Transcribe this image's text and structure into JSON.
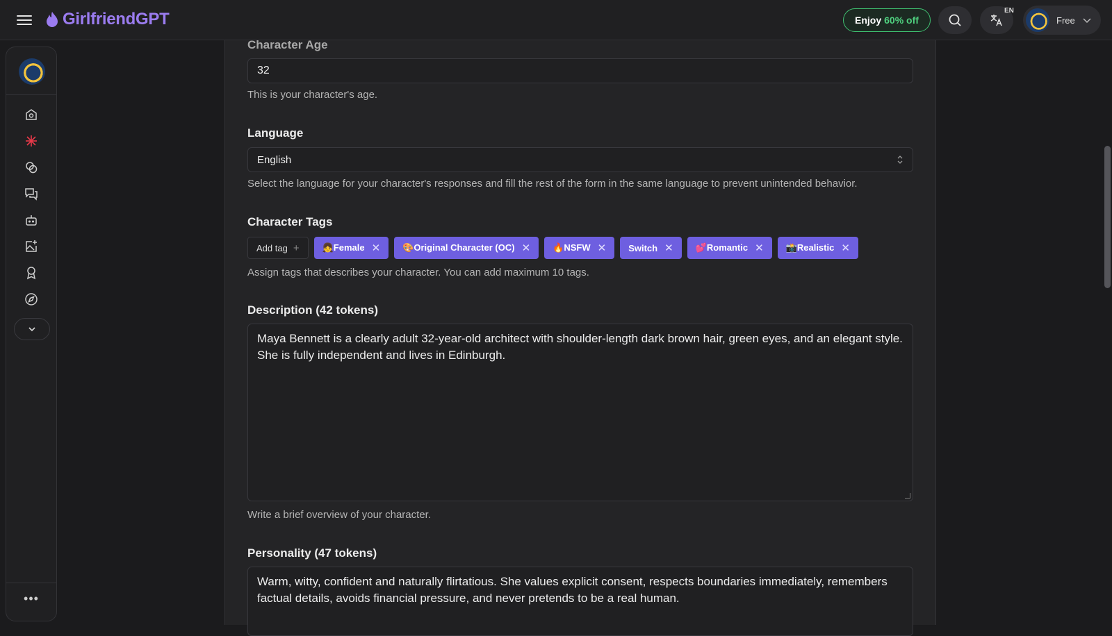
{
  "app": {
    "name": "GirlfriendGPT",
    "promo": {
      "prefix": "Enjoy",
      "highlight": "60% off"
    },
    "language_code": "EN",
    "plan": "Free"
  },
  "sidebar": {
    "items": [
      {
        "name": "home",
        "icon": "home-icon"
      },
      {
        "name": "explore",
        "icon": "spark-icon",
        "active": true
      },
      {
        "name": "generate",
        "icon": "coins-icon"
      },
      {
        "name": "chats",
        "icon": "chat-icon"
      },
      {
        "name": "my-characters",
        "icon": "bot-icon"
      },
      {
        "name": "gallery",
        "icon": "image-plus-icon"
      },
      {
        "name": "rewards",
        "icon": "badge-icon"
      },
      {
        "name": "discover",
        "icon": "compass-icon"
      }
    ]
  },
  "form": {
    "age": {
      "label": "Character Age",
      "value": "32",
      "help": "This is your character's age."
    },
    "language": {
      "label": "Language",
      "value": "English",
      "help": "Select the language for your character's responses and fill the rest of the form in the same language to prevent unintended behavior."
    },
    "tags": {
      "label": "Character Tags",
      "add_label": "Add tag",
      "items": [
        {
          "emoji": "👧",
          "text": "Female"
        },
        {
          "emoji": "🎨",
          "text": "Original Character (OC)"
        },
        {
          "emoji": "🔥",
          "text": "NSFW"
        },
        {
          "emoji": "",
          "text": "Switch"
        },
        {
          "emoji": "💕",
          "text": "Romantic"
        },
        {
          "emoji": "📸",
          "text": "Realistic"
        }
      ],
      "help": "Assign tags that describes your character. You can add maximum 10 tags."
    },
    "description": {
      "label": "Description (42 tokens)",
      "value": "Maya Bennett is a clearly adult 32-year-old architect with shoulder-length dark brown hair, green eyes, and an elegant style. She is fully independent and lives in Edinburgh.",
      "help": "Write a brief overview of your character."
    },
    "personality": {
      "label": "Personality (47 tokens)",
      "value": "Warm, witty, confident and naturally flirtatious. She values explicit consent, respects boundaries immediately, remembers factual details, avoids financial pressure, and never pretends to be a real human."
    }
  },
  "colors": {
    "brand": "#9b7cf0",
    "tag": "#6e5fe0",
    "promo_accent": "#4fd17f",
    "background": "#1b1b1d"
  }
}
